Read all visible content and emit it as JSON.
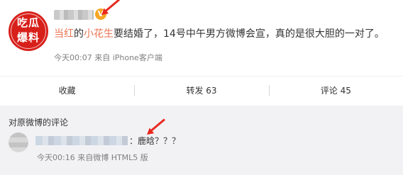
{
  "post": {
    "avatar_text": "吃瓜爆料",
    "verified_badge": "V",
    "text_parts": [
      "当红",
      "的",
      "小花生",
      "要结婚了，14号中午男方微博会宣，真的是很大胆的一对了。"
    ],
    "meta": "今天00:07 来自 iPhone客户端"
  },
  "actions": {
    "favorite": "收藏",
    "repost": "转发 63",
    "comment": "评论 45"
  },
  "comments": {
    "section_title": "对原微博的评论",
    "item": {
      "text": "：鹿晗？？？",
      "meta": "今天00:16 来自微博 HTML5 版"
    }
  },
  "colors": {
    "accent": "#eb7350",
    "annotation_arrow": "#e8291f",
    "avatar_bg": "#d8201b"
  }
}
